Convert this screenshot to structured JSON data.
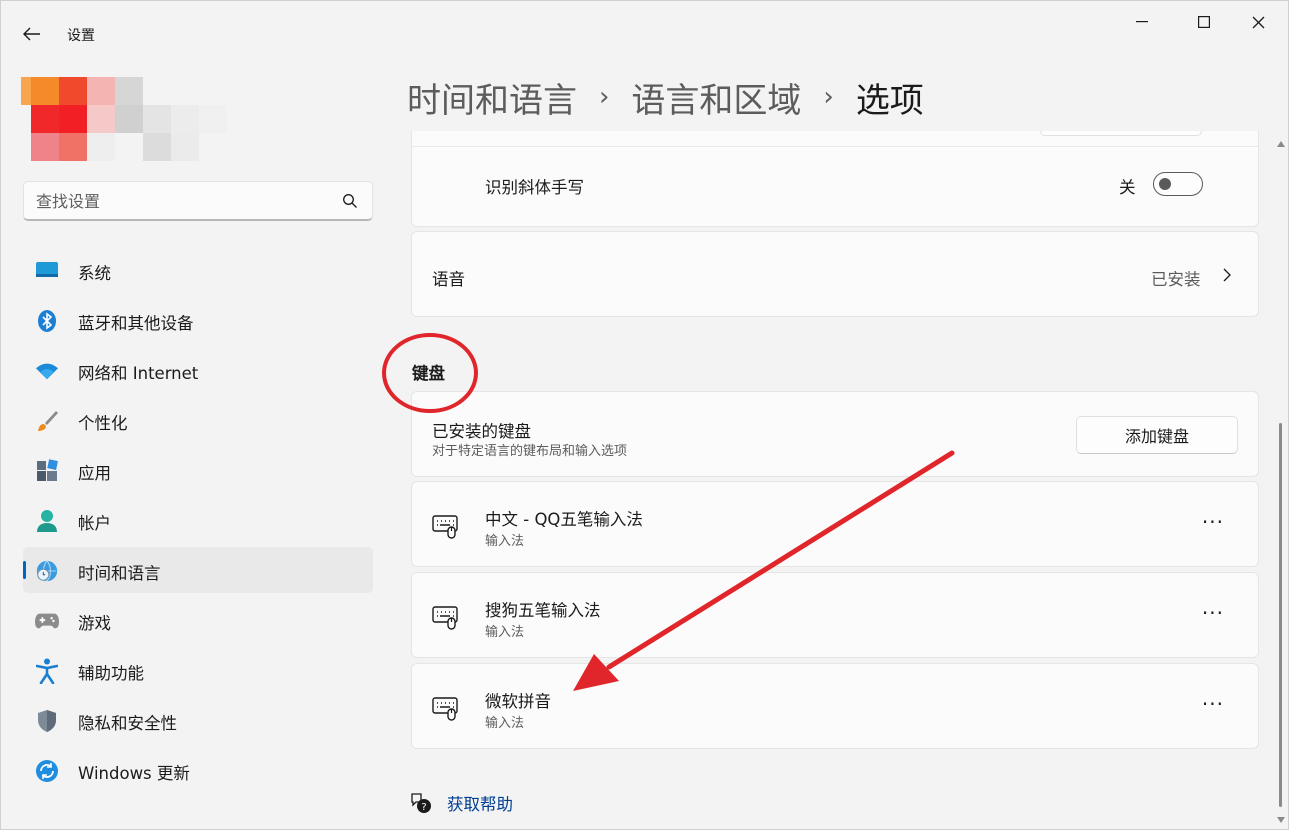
{
  "app": {
    "title": "设置"
  },
  "search": {
    "placeholder": "查找设置"
  },
  "nav": {
    "items": [
      {
        "label": "系统",
        "icon": "system-icon"
      },
      {
        "label": "蓝牙和其他设备",
        "icon": "bluetooth-icon"
      },
      {
        "label": "网络和 Internet",
        "icon": "wifi-icon"
      },
      {
        "label": "个性化",
        "icon": "brush-icon"
      },
      {
        "label": "应用",
        "icon": "apps-icon"
      },
      {
        "label": "帐户",
        "icon": "account-icon"
      },
      {
        "label": "时间和语言",
        "icon": "time-language-icon",
        "active": true
      },
      {
        "label": "游戏",
        "icon": "gamepad-icon"
      },
      {
        "label": "辅助功能",
        "icon": "accessibility-icon"
      },
      {
        "label": "隐私和安全性",
        "icon": "shield-icon"
      },
      {
        "label": "Windows 更新",
        "icon": "update-icon"
      }
    ]
  },
  "breadcrumb": {
    "parts": [
      "时间和语言",
      "语言和区域"
    ],
    "separator": "›",
    "current": "选项"
  },
  "handwriting": {
    "label": "识别斜体手写",
    "state_label": "关",
    "on": false
  },
  "speech": {
    "label": "语音",
    "status": "已安装"
  },
  "keyboard": {
    "heading": "键盘",
    "installed_title": "已安装的键盘",
    "installed_desc": "对于特定语言的键布局和输入选项",
    "add_button": "添加键盘",
    "items": [
      {
        "title": "中文 - QQ五笔输入法",
        "subtitle": "输入法"
      },
      {
        "title": "搜狗五笔输入法",
        "subtitle": "输入法"
      },
      {
        "title": "微软拼音",
        "subtitle": "输入法"
      }
    ],
    "more_label": "···"
  },
  "help": {
    "label": "获取帮助"
  },
  "colors": {
    "accent": "#0067c0",
    "annotation": "#e0252b",
    "background": "#f3f3f3",
    "card": "#fbfbfb"
  }
}
